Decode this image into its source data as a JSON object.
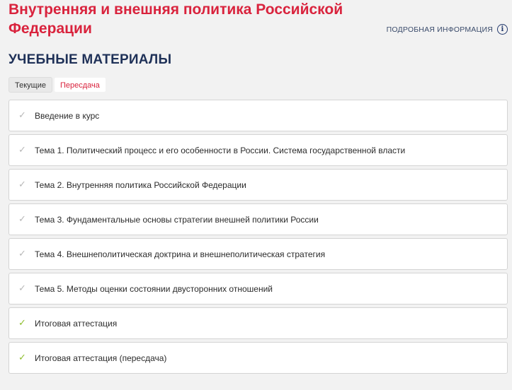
{
  "course": {
    "title": "Внутренняя и внешняя политика Российской Федерации"
  },
  "info": {
    "label": "ПОДРОБНАЯ ИНФОРМАЦИЯ",
    "icon": "info-icon"
  },
  "section": {
    "title": "УЧЕБНЫЕ МАТЕРИАЛЫ"
  },
  "tabs": [
    {
      "label": "Текущие"
    },
    {
      "label": "Пересдача"
    }
  ],
  "materials": [
    {
      "label": "Введение в курс",
      "status": "gray-check"
    },
    {
      "label": "Тема 1. Политический процесс и его особенности в России. Система государственной власти",
      "status": "gray-check"
    },
    {
      "label": "Тема 2. Внутренняя политика Российской Федерации",
      "status": "gray-check"
    },
    {
      "label": "Тема 3. Фундаментальные основы стратегии внешней политики России",
      "status": "gray-check"
    },
    {
      "label": "Тема 4. Внешнеполитическая доктрина и внешнеполитическая стратегия",
      "status": "gray-check"
    },
    {
      "label": "Тема 5. Методы оценки состоянии двусторонних отношений",
      "status": "gray-check"
    },
    {
      "label": "Итоговая аттестация",
      "status": "green-check"
    },
    {
      "label": "Итоговая аттестация (пересдача)",
      "status": "green-check"
    }
  ],
  "colors": {
    "accent_red": "#d9233d",
    "heading_navy": "#1f3158",
    "check_gray": "#b8b8b8",
    "check_green": "#8fbe2f"
  }
}
